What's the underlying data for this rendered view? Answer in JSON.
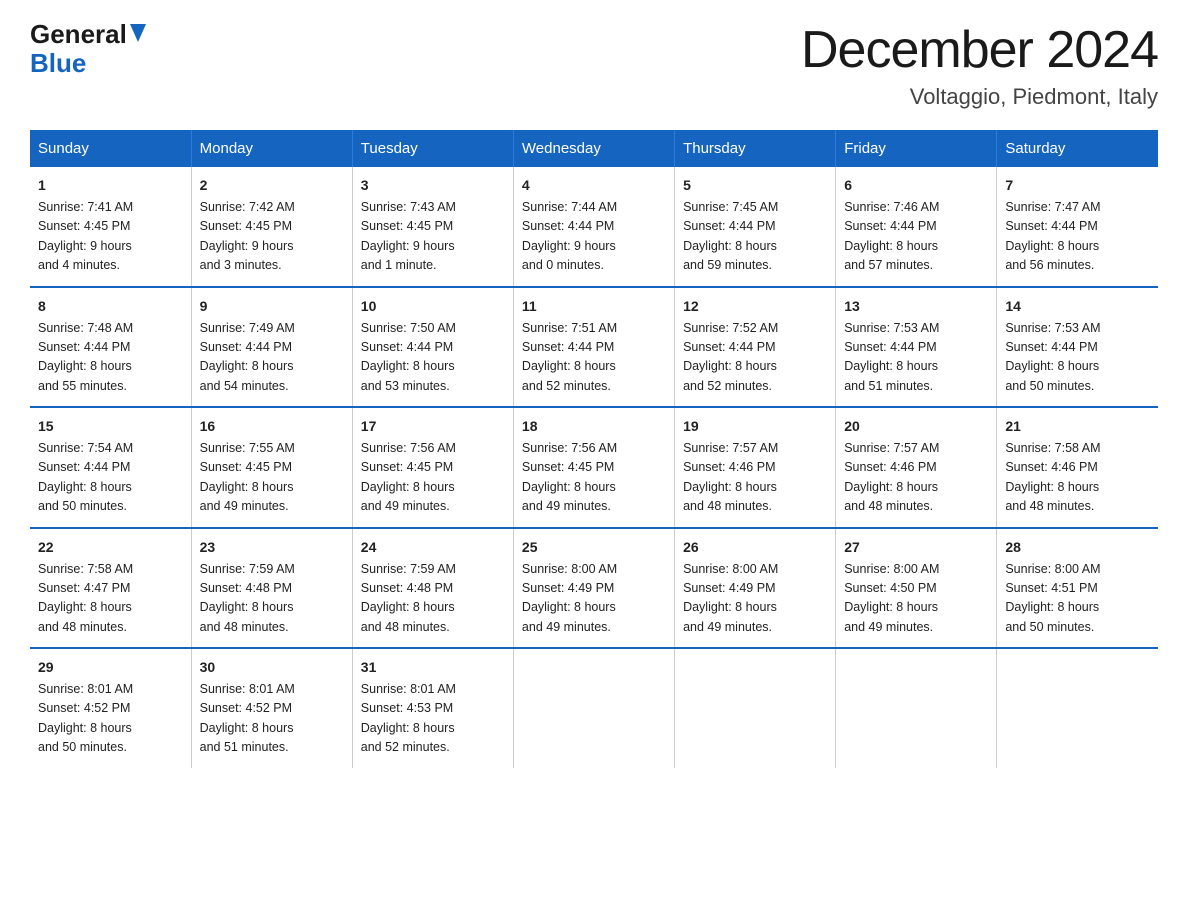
{
  "header": {
    "logo_general": "General",
    "logo_blue": "Blue",
    "month_title": "December 2024",
    "location": "Voltaggio, Piedmont, Italy"
  },
  "days_of_week": [
    "Sunday",
    "Monday",
    "Tuesday",
    "Wednesday",
    "Thursday",
    "Friday",
    "Saturday"
  ],
  "weeks": [
    [
      {
        "day": "1",
        "info": "Sunrise: 7:41 AM\nSunset: 4:45 PM\nDaylight: 9 hours\nand 4 minutes."
      },
      {
        "day": "2",
        "info": "Sunrise: 7:42 AM\nSunset: 4:45 PM\nDaylight: 9 hours\nand 3 minutes."
      },
      {
        "day": "3",
        "info": "Sunrise: 7:43 AM\nSunset: 4:45 PM\nDaylight: 9 hours\nand 1 minute."
      },
      {
        "day": "4",
        "info": "Sunrise: 7:44 AM\nSunset: 4:44 PM\nDaylight: 9 hours\nand 0 minutes."
      },
      {
        "day": "5",
        "info": "Sunrise: 7:45 AM\nSunset: 4:44 PM\nDaylight: 8 hours\nand 59 minutes."
      },
      {
        "day": "6",
        "info": "Sunrise: 7:46 AM\nSunset: 4:44 PM\nDaylight: 8 hours\nand 57 minutes."
      },
      {
        "day": "7",
        "info": "Sunrise: 7:47 AM\nSunset: 4:44 PM\nDaylight: 8 hours\nand 56 minutes."
      }
    ],
    [
      {
        "day": "8",
        "info": "Sunrise: 7:48 AM\nSunset: 4:44 PM\nDaylight: 8 hours\nand 55 minutes."
      },
      {
        "day": "9",
        "info": "Sunrise: 7:49 AM\nSunset: 4:44 PM\nDaylight: 8 hours\nand 54 minutes."
      },
      {
        "day": "10",
        "info": "Sunrise: 7:50 AM\nSunset: 4:44 PM\nDaylight: 8 hours\nand 53 minutes."
      },
      {
        "day": "11",
        "info": "Sunrise: 7:51 AM\nSunset: 4:44 PM\nDaylight: 8 hours\nand 52 minutes."
      },
      {
        "day": "12",
        "info": "Sunrise: 7:52 AM\nSunset: 4:44 PM\nDaylight: 8 hours\nand 52 minutes."
      },
      {
        "day": "13",
        "info": "Sunrise: 7:53 AM\nSunset: 4:44 PM\nDaylight: 8 hours\nand 51 minutes."
      },
      {
        "day": "14",
        "info": "Sunrise: 7:53 AM\nSunset: 4:44 PM\nDaylight: 8 hours\nand 50 minutes."
      }
    ],
    [
      {
        "day": "15",
        "info": "Sunrise: 7:54 AM\nSunset: 4:44 PM\nDaylight: 8 hours\nand 50 minutes."
      },
      {
        "day": "16",
        "info": "Sunrise: 7:55 AM\nSunset: 4:45 PM\nDaylight: 8 hours\nand 49 minutes."
      },
      {
        "day": "17",
        "info": "Sunrise: 7:56 AM\nSunset: 4:45 PM\nDaylight: 8 hours\nand 49 minutes."
      },
      {
        "day": "18",
        "info": "Sunrise: 7:56 AM\nSunset: 4:45 PM\nDaylight: 8 hours\nand 49 minutes."
      },
      {
        "day": "19",
        "info": "Sunrise: 7:57 AM\nSunset: 4:46 PM\nDaylight: 8 hours\nand 48 minutes."
      },
      {
        "day": "20",
        "info": "Sunrise: 7:57 AM\nSunset: 4:46 PM\nDaylight: 8 hours\nand 48 minutes."
      },
      {
        "day": "21",
        "info": "Sunrise: 7:58 AM\nSunset: 4:46 PM\nDaylight: 8 hours\nand 48 minutes."
      }
    ],
    [
      {
        "day": "22",
        "info": "Sunrise: 7:58 AM\nSunset: 4:47 PM\nDaylight: 8 hours\nand 48 minutes."
      },
      {
        "day": "23",
        "info": "Sunrise: 7:59 AM\nSunset: 4:48 PM\nDaylight: 8 hours\nand 48 minutes."
      },
      {
        "day": "24",
        "info": "Sunrise: 7:59 AM\nSunset: 4:48 PM\nDaylight: 8 hours\nand 48 minutes."
      },
      {
        "day": "25",
        "info": "Sunrise: 8:00 AM\nSunset: 4:49 PM\nDaylight: 8 hours\nand 49 minutes."
      },
      {
        "day": "26",
        "info": "Sunrise: 8:00 AM\nSunset: 4:49 PM\nDaylight: 8 hours\nand 49 minutes."
      },
      {
        "day": "27",
        "info": "Sunrise: 8:00 AM\nSunset: 4:50 PM\nDaylight: 8 hours\nand 49 minutes."
      },
      {
        "day": "28",
        "info": "Sunrise: 8:00 AM\nSunset: 4:51 PM\nDaylight: 8 hours\nand 50 minutes."
      }
    ],
    [
      {
        "day": "29",
        "info": "Sunrise: 8:01 AM\nSunset: 4:52 PM\nDaylight: 8 hours\nand 50 minutes."
      },
      {
        "day": "30",
        "info": "Sunrise: 8:01 AM\nSunset: 4:52 PM\nDaylight: 8 hours\nand 51 minutes."
      },
      {
        "day": "31",
        "info": "Sunrise: 8:01 AM\nSunset: 4:53 PM\nDaylight: 8 hours\nand 52 minutes."
      },
      {
        "day": "",
        "info": ""
      },
      {
        "day": "",
        "info": ""
      },
      {
        "day": "",
        "info": ""
      },
      {
        "day": "",
        "info": ""
      }
    ]
  ]
}
